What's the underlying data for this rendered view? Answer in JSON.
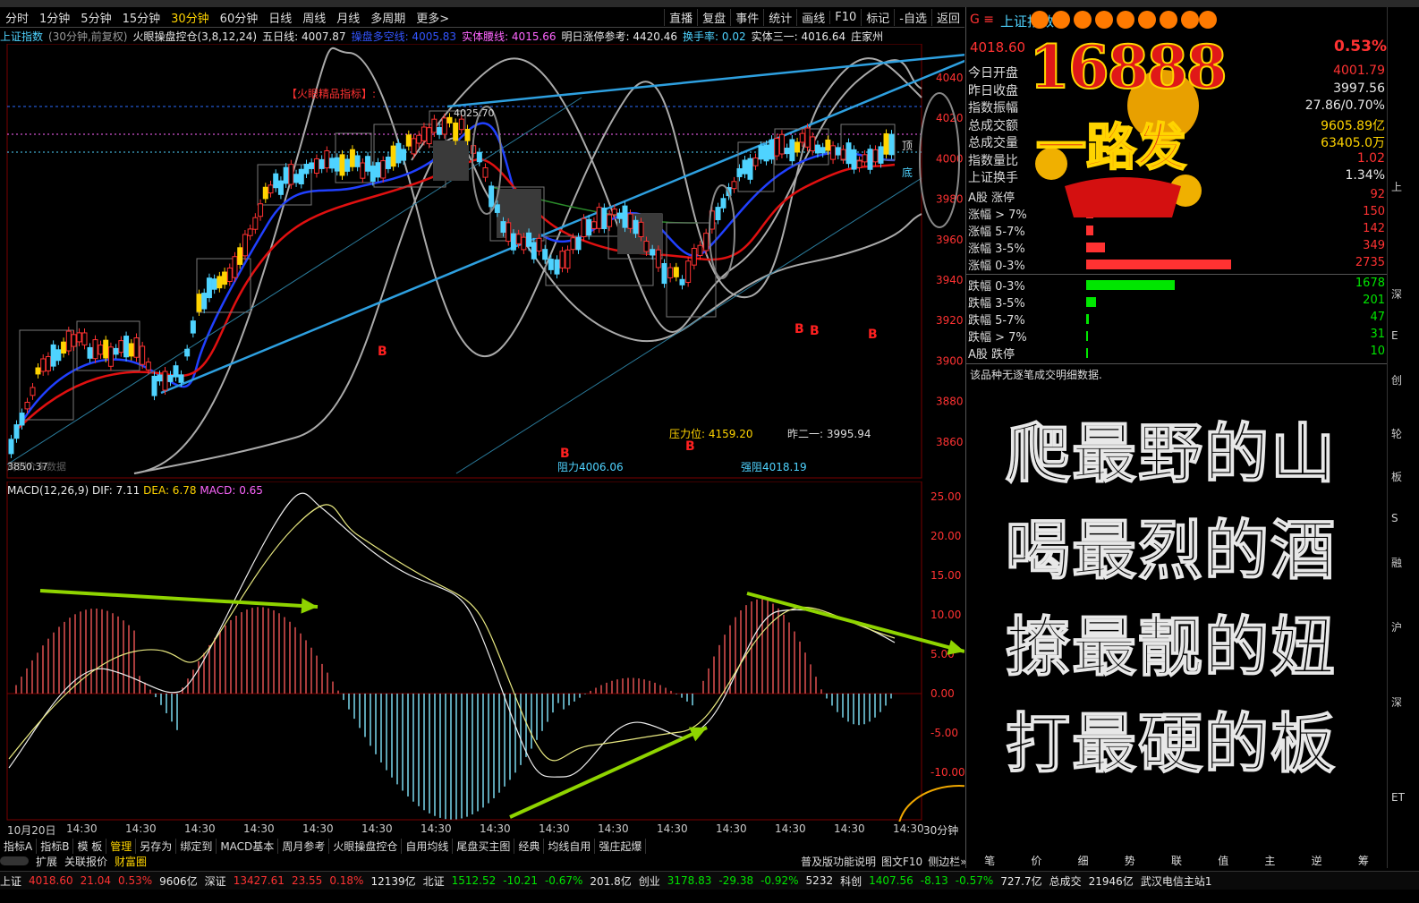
{
  "periods": [
    "分时",
    "1分钟",
    "5分钟",
    "15分钟",
    "30分钟",
    "60分钟",
    "日线",
    "周线",
    "月线",
    "多周期",
    "更多>"
  ],
  "active_period": "30分钟",
  "toolbar_right": [
    "直播",
    "复盘",
    "事件",
    "统计",
    "画线",
    "F10",
    "标记",
    "-自选",
    "返回"
  ],
  "info": {
    "index_name": "上证指数",
    "period_desc": "(30分钟,前复权)",
    "indicator": "火眼操盘控仓(3,8,12,24)",
    "ma5": "五日线: 4007.87",
    "ctrl_line": "操盘多空线: 4005.83",
    "waist_line": "实体腰线: 4015.66",
    "limit_ref": "明日涨停参考: 4420.46",
    "turnover": "换手率: 0.02",
    "entity": "实体三一: 4016.64",
    "more": "庄家州"
  },
  "main_chart": {
    "y_ticks": [
      "4040",
      "4020",
      "4000",
      "3980",
      "3960",
      "3940",
      "3920",
      "3900",
      "3880",
      "3860"
    ],
    "annotations": {
      "high_mark": "4025.70",
      "low_mark": "3850.37",
      "indicator_tag": "【火眼精品指标】:",
      "pressure": "压力位: 4159.20",
      "prev_close": "昨二一: 3995.94",
      "resistance": "阻力4006.06",
      "strong_resist": "强阻4018.19",
      "top_tag": "顶",
      "bottom_tag": "底",
      "bottom_left": "周到介东数据",
      "b_label": "B"
    }
  },
  "macd": {
    "title": "MACD(12,26,9)",
    "dif": "DIF: 7.11",
    "dea": "DEA: 6.78",
    "macd": "MACD: 0.65",
    "y_ticks": [
      "25.00",
      "20.00",
      "15.00",
      "10.00",
      "5.00",
      "0.00",
      "-5.00",
      "-10.00"
    ]
  },
  "x_axis": [
    "10月20日",
    "14:30",
    "14:30",
    "14:30",
    "14:30",
    "14:30",
    "14:30",
    "14:30",
    "14:30",
    "14:30",
    "14:30",
    "14:30",
    "14:30",
    "14:30",
    "14:30",
    "14:30"
  ],
  "x_period": "30分钟",
  "bottom_tabs": [
    "指标A",
    "指标B",
    "模 板",
    "管理",
    "另存为",
    "绑定到",
    "MACD基本",
    "周月参考",
    "火眼操盘控仓",
    "自用均线",
    "尾盘买主图",
    "经典",
    "均线自用",
    "强庄起爆"
  ],
  "bottom_tabs2": [
    "扩展",
    "关联报价",
    "财富圈"
  ],
  "bottom_right": [
    "普及版功能说明",
    "图文F10",
    "侧边栏»"
  ],
  "right_panel": {
    "name": "上证指数",
    "price": "4018.60",
    "change_pct": "0.53%",
    "stats": [
      {
        "label": "今日开盘",
        "value": "4001.79",
        "color": "#ff3232"
      },
      {
        "label": "昨日收盘",
        "value": "3997.56",
        "color": "#e8e8e8"
      },
      {
        "label": "指数振幅",
        "value": "27.86/0.70%",
        "color": "#e8e8e8"
      },
      {
        "label": "总成交额",
        "value": "9605.89亿",
        "color": "#ffd400"
      },
      {
        "label": "总成交量",
        "value": "63405.0万",
        "color": "#ffd400"
      },
      {
        "label": "指数量比",
        "value": "1.02",
        "color": "#ff3232"
      },
      {
        "label": "上证换手",
        "value": "1.34%",
        "color": "#e8e8e8"
      }
    ],
    "up_dist": [
      {
        "label": "A股 涨停",
        "value": "92",
        "frac": 0.0
      },
      {
        "label": "涨幅 > 7%",
        "value": "150",
        "frac": 0.05
      },
      {
        "label": "涨幅 5-7%",
        "value": "142",
        "frac": 0.05
      },
      {
        "label": "涨幅 3-5%",
        "value": "349",
        "frac": 0.13
      },
      {
        "label": "涨幅 0-3%",
        "value": "2735",
        "frac": 1.0
      }
    ],
    "down_dist": [
      {
        "label": "跌幅 0-3%",
        "value": "1678",
        "frac": 0.61
      },
      {
        "label": "跌幅 3-5%",
        "value": "201",
        "frac": 0.07
      },
      {
        "label": "跌幅 5-7%",
        "value": "47",
        "frac": 0.02
      },
      {
        "label": "跌幅 > 7%",
        "value": "31",
        "frac": 0.01
      },
      {
        "label": "A股 跌停",
        "value": "10",
        "frac": 0.005
      }
    ],
    "no_detail": "该品种无逐笔成交明细数据.",
    "banner_number": "16888",
    "banner_slogan": "一路发",
    "poem": [
      "爬最野的山",
      "喝最烈的酒",
      "撩最靓的妞",
      "打最硬的板"
    ],
    "tabs": [
      "笔",
      "价",
      "细",
      "势",
      "联",
      "值",
      "主",
      "逆",
      "筹"
    ]
  },
  "statusbar": [
    {
      "t": "上证",
      "c": "#e8e8e8"
    },
    {
      "t": "4018.60",
      "c": "#ff3232"
    },
    {
      "t": "21.04",
      "c": "#ff3232"
    },
    {
      "t": "0.53%",
      "c": "#ff3232"
    },
    {
      "t": "9606亿",
      "c": "#e8e8e8"
    },
    {
      "t": "深证",
      "c": "#e8e8e8"
    },
    {
      "t": "13427.61",
      "c": "#ff3232"
    },
    {
      "t": "23.55",
      "c": "#ff3232"
    },
    {
      "t": "0.18%",
      "c": "#ff3232"
    },
    {
      "t": "12139亿",
      "c": "#e8e8e8"
    },
    {
      "t": "北证",
      "c": "#e8e8e8"
    },
    {
      "t": "1512.52",
      "c": "#00e600"
    },
    {
      "t": "-10.21",
      "c": "#00e600"
    },
    {
      "t": "-0.67%",
      "c": "#00e600"
    },
    {
      "t": "201.8亿",
      "c": "#e8e8e8"
    },
    {
      "t": "创业",
      "c": "#e8e8e8"
    },
    {
      "t": "3178.83",
      "c": "#00e600"
    },
    {
      "t": "-29.38",
      "c": "#00e600"
    },
    {
      "t": "-0.92%",
      "c": "#00e600"
    },
    {
      "t": "5232",
      "c": "#e8e8e8"
    },
    {
      "t": "科创",
      "c": "#e8e8e8"
    },
    {
      "t": "1407.56",
      "c": "#00e600"
    },
    {
      "t": "-8.13",
      "c": "#00e600"
    },
    {
      "t": "-0.57%",
      "c": "#00e600"
    },
    {
      "t": "727.7亿",
      "c": "#e8e8e8"
    },
    {
      "t": "总成交",
      "c": "#e8e8e8"
    },
    {
      "t": "21946亿",
      "c": "#e8e8e8"
    },
    {
      "t": "武汉电信主站1",
      "c": "#e8e8e8"
    }
  ],
  "edge_text": [
    "上",
    "深",
    "E",
    "创",
    "轮",
    "板",
    "S",
    "融",
    "沪",
    "深",
    "ET"
  ],
  "colors": {
    "up": "#ff3232",
    "down": "#00e600",
    "yellow": "#ffd400",
    "cyan": "#4fd3ff",
    "blue": "#1e90ff",
    "lime": "#8fd400"
  }
}
